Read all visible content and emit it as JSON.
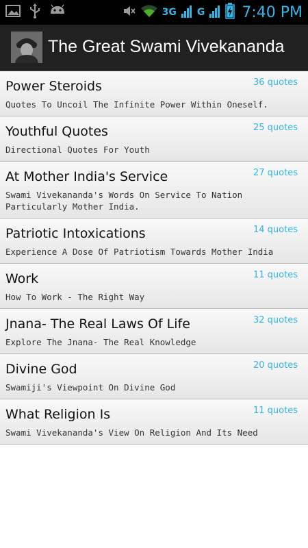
{
  "status_bar": {
    "time": "7:40 PM",
    "network_1": "3G",
    "network_2": "G",
    "icons": [
      "image-icon",
      "usb-icon",
      "android-icon",
      "mute-icon",
      "wifi-icon",
      "signal-icon",
      "battery-icon"
    ]
  },
  "action_bar": {
    "title": "The Great Swami Vivekananda"
  },
  "colors": {
    "accent": "#33b5e5",
    "action_bar": "#212121"
  },
  "items": [
    {
      "title": "Power Steroids",
      "count": "36 quotes",
      "description": "Quotes To Uncoil The Infinite Power Within Oneself."
    },
    {
      "title": "Youthful Quotes",
      "count": "25 quotes",
      "description": "Directional Quotes For Youth"
    },
    {
      "title": "At Mother India's Service",
      "count": "27 quotes",
      "description": "Swami Vivekananda's Words On Service To Nation Particularly Mother India."
    },
    {
      "title": "Patriotic Intoxications",
      "count": "14 quotes",
      "description": "Experience A Dose Of Patriotism Towards Mother India"
    },
    {
      "title": "Work",
      "count": "11 quotes",
      "description": "How To Work - The Right Way"
    },
    {
      "title": "Jnana- The Real Laws Of Life",
      "count": "32 quotes",
      "description": "Explore The Jnana- The Real Knowledge"
    },
    {
      "title": "Divine God",
      "count": "20 quotes",
      "description": "Swamiji's Viewpoint On Divine God"
    },
    {
      "title": "What Religion Is",
      "count": "11 quotes",
      "description": "Swami Vivekananda's View On Religion And Its Need"
    }
  ]
}
